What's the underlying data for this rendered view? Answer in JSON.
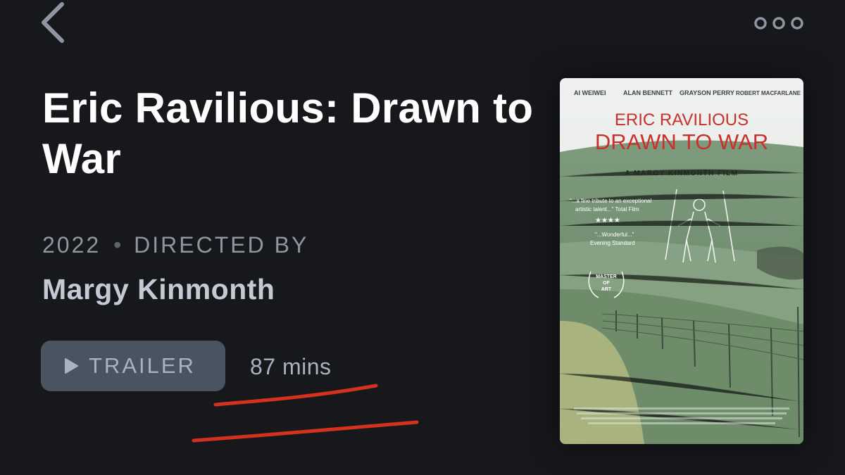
{
  "header": {
    "back_icon": "chevron-left-icon",
    "more_icon": "more-horizontal-icon"
  },
  "film": {
    "title": "Eric Ravilious: Drawn to War",
    "year": "2022",
    "separator": "•",
    "directed_by_label": "DIRECTED BY",
    "director": "Margy Kinmonth",
    "runtime": "87 mins"
  },
  "trailer": {
    "label": "TRAILER",
    "icon": "play-icon"
  },
  "poster": {
    "cast_1": "AI WEIWEI",
    "cast_2": "ALAN BENNETT",
    "cast_3": "GRAYSON PERRY",
    "cast_4": "ROBERT MACFARLANE",
    "title_line1": "ERIC RAVILIOUS",
    "title_line2": "DRAWN TO WAR",
    "subtitle": "A MARGY KINMONTH FILM",
    "quote1_line1": "\"...a fine tribute to an exceptional",
    "quote1_line2": "artistic talent...\" Total Film",
    "stars": "★★★★",
    "quote2_line1": "\"...Wonderful...\"",
    "quote2_line2": "Evening Standard",
    "laurel_line1": "MASTER",
    "laurel_line2": "OF",
    "laurel_line3": "ART"
  },
  "colors": {
    "background": "#16181c",
    "button_bg": "#4a5461",
    "annotation_red": "#d2321f",
    "poster_title_red": "#c9302c"
  }
}
